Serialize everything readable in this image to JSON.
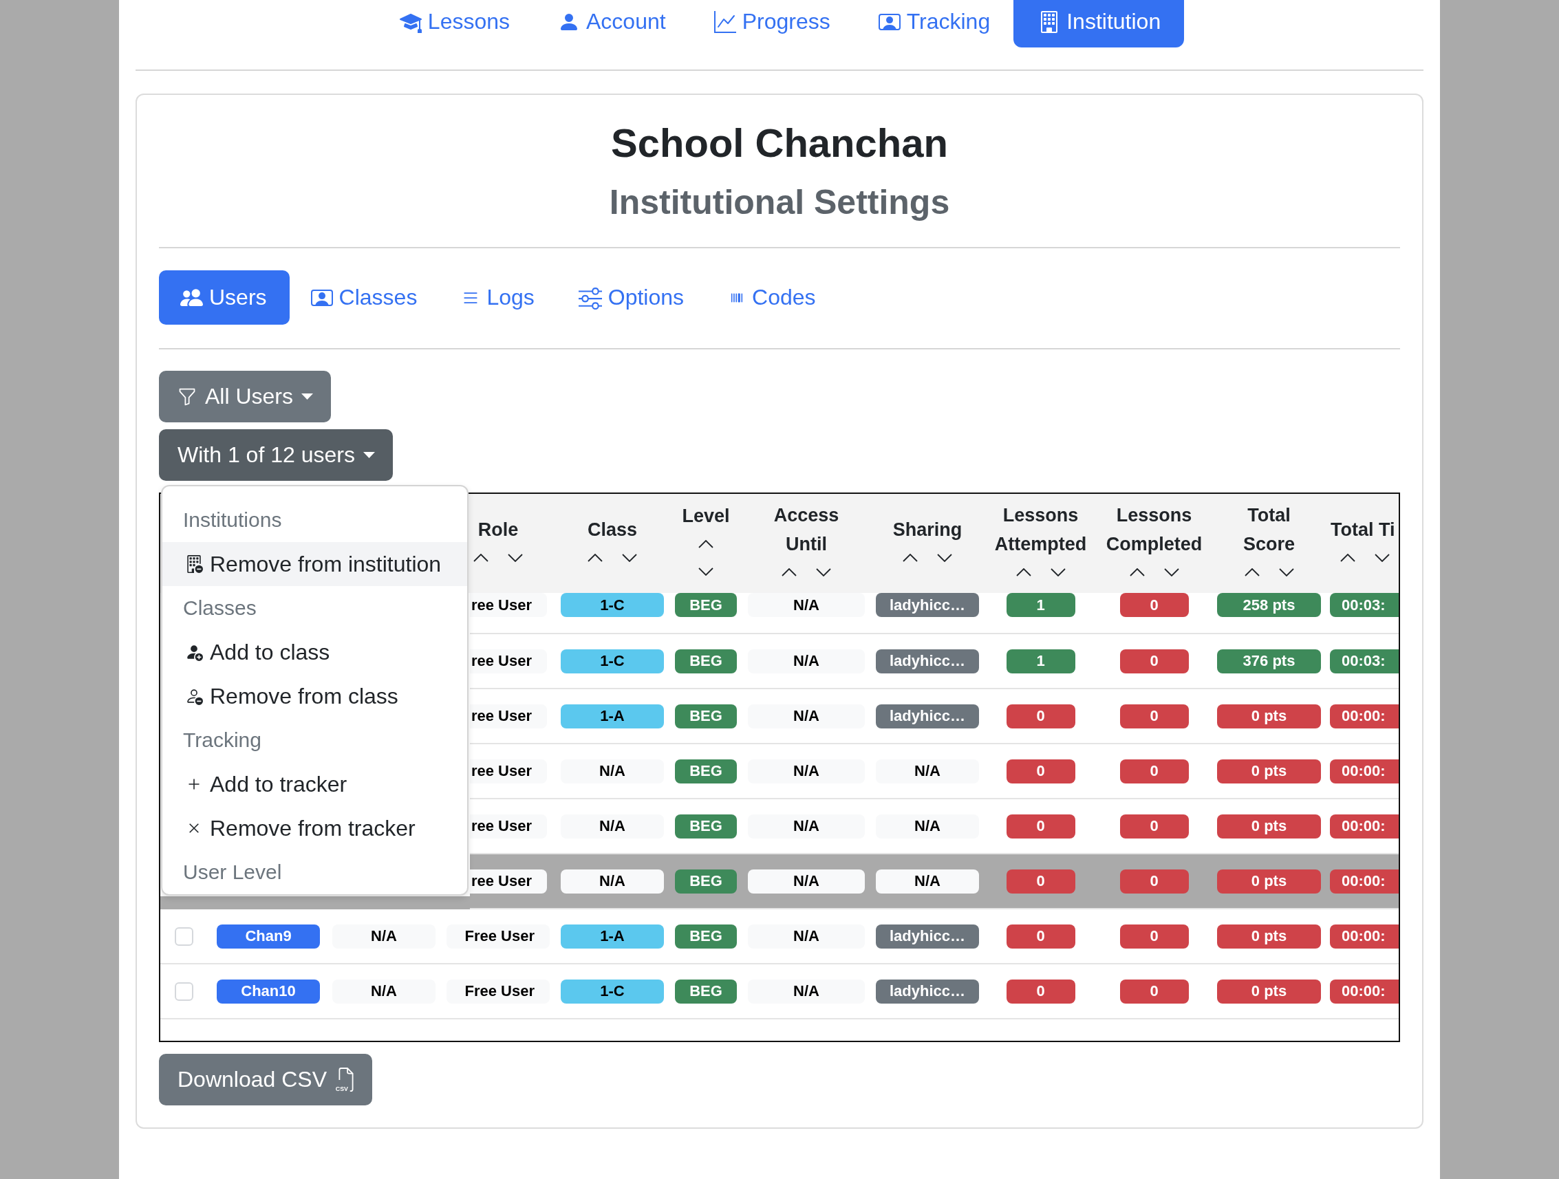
{
  "nav": {
    "items": [
      {
        "label": "Lessons",
        "selected": false
      },
      {
        "label": "Account",
        "selected": false
      },
      {
        "label": "Progress",
        "selected": false
      },
      {
        "label": "Tracking",
        "selected": false
      },
      {
        "label": "Institution",
        "selected": true
      }
    ]
  },
  "header": {
    "title": "School Chanchan",
    "subtitle": "Institutional Settings"
  },
  "tabs": [
    {
      "label": "Users",
      "selected": true
    },
    {
      "label": "Classes",
      "selected": false
    },
    {
      "label": "Logs",
      "selected": false
    },
    {
      "label": "Options",
      "selected": false
    },
    {
      "label": "Codes",
      "selected": false
    }
  ],
  "filter_button": {
    "label": "All Users"
  },
  "bulk_button": {
    "label": "With 1 of 12 users",
    "expanded": true
  },
  "bulk_menu": [
    {
      "kind": "header",
      "label": "Institutions"
    },
    {
      "kind": "item",
      "label": "Remove from institution",
      "highlighted": true
    },
    {
      "kind": "header",
      "label": "Classes"
    },
    {
      "kind": "item",
      "label": "Add to class",
      "highlighted": false
    },
    {
      "kind": "item",
      "label": "Remove from class",
      "highlighted": false
    },
    {
      "kind": "header",
      "label": "Tracking"
    },
    {
      "kind": "item",
      "label": "Add to tracker",
      "highlighted": false
    },
    {
      "kind": "item",
      "label": "Remove from tracker",
      "highlighted": false
    },
    {
      "kind": "header",
      "label": "User Level"
    }
  ],
  "table": {
    "columns": [
      {
        "label": "Role"
      },
      {
        "label": "Class"
      },
      {
        "label": "Level"
      },
      {
        "label": "Access Until"
      },
      {
        "label": "Sharing"
      },
      {
        "label": "Lessons Attempted"
      },
      {
        "label": "Lessons Completed"
      },
      {
        "label": "Total Score"
      },
      {
        "label": "Total Ti"
      }
    ],
    "rows": [
      {
        "selected": false,
        "role": {
          "text": "ree User",
          "color": "#f8f9fa"
        },
        "class": {
          "text": "1-C",
          "color": "#5bc8ee"
        },
        "level": {
          "text": "BEG",
          "color": "#3e8a5a"
        },
        "access_until": {
          "text": "N/A",
          "color": "#f8f9fa"
        },
        "sharing": {
          "text": "ladyhicc…",
          "color": "#6c757d"
        },
        "lessons_attempted": {
          "text": "1",
          "color": "#3e8a5a"
        },
        "lessons_completed": {
          "text": "0",
          "color": "#cf4349"
        },
        "total_score": {
          "text": "258 pts",
          "color": "#3e8a5a"
        },
        "column_12": {
          "text": "00:03:",
          "color": "#3e8a5a"
        }
      },
      {
        "selected": false,
        "role": {
          "text": "ree User",
          "color": "#f8f9fa"
        },
        "class": {
          "text": "1-C",
          "color": "#5bc8ee"
        },
        "level": {
          "text": "BEG",
          "color": "#3e8a5a"
        },
        "access_until": {
          "text": "N/A",
          "color": "#f8f9fa"
        },
        "sharing": {
          "text": "ladyhicc…",
          "color": "#6c757d"
        },
        "lessons_attempted": {
          "text": "1",
          "color": "#3e8a5a"
        },
        "lessons_completed": {
          "text": "0",
          "color": "#cf4349"
        },
        "total_score": {
          "text": "376 pts",
          "color": "#3e8a5a"
        },
        "column_12": {
          "text": "00:03:",
          "color": "#3e8a5a"
        }
      },
      {
        "selected": false,
        "role": {
          "text": "ree User",
          "color": "#f8f9fa"
        },
        "class": {
          "text": "1-A",
          "color": "#5bc8ee"
        },
        "level": {
          "text": "BEG",
          "color": "#3e8a5a"
        },
        "access_until": {
          "text": "N/A",
          "color": "#f8f9fa"
        },
        "sharing": {
          "text": "ladyhicc…",
          "color": "#6c757d"
        },
        "lessons_attempted": {
          "text": "0",
          "color": "#cf4349"
        },
        "lessons_completed": {
          "text": "0",
          "color": "#cf4349"
        },
        "total_score": {
          "text": "0 pts",
          "color": "#cf4349"
        },
        "column_12": {
          "text": "00:00:",
          "color": "#cf4349"
        }
      },
      {
        "selected": false,
        "role": {
          "text": "ree User",
          "color": "#f8f9fa"
        },
        "class": {
          "text": "N/A",
          "color": "#f8f9fa"
        },
        "level": {
          "text": "BEG",
          "color": "#3e8a5a"
        },
        "access_until": {
          "text": "N/A",
          "color": "#f8f9fa"
        },
        "sharing": {
          "text": "N/A",
          "color": "#f8f9fa"
        },
        "lessons_attempted": {
          "text": "0",
          "color": "#cf4349"
        },
        "lessons_completed": {
          "text": "0",
          "color": "#cf4349"
        },
        "total_score": {
          "text": "0 pts",
          "color": "#cf4349"
        },
        "column_12": {
          "text": "00:00:",
          "color": "#cf4349"
        }
      },
      {
        "selected": false,
        "role": {
          "text": "ree User",
          "color": "#f8f9fa"
        },
        "class": {
          "text": "N/A",
          "color": "#f8f9fa"
        },
        "level": {
          "text": "BEG",
          "color": "#3e8a5a"
        },
        "access_until": {
          "text": "N/A",
          "color": "#f8f9fa"
        },
        "sharing": {
          "text": "N/A",
          "color": "#f8f9fa"
        },
        "lessons_attempted": {
          "text": "0",
          "color": "#cf4349"
        },
        "lessons_completed": {
          "text": "0",
          "color": "#cf4349"
        },
        "total_score": {
          "text": "0 pts",
          "color": "#cf4349"
        },
        "column_12": {
          "text": "00:00:",
          "color": "#cf4349"
        }
      },
      {
        "selected": true,
        "role": {
          "text": "ree User",
          "color": "#f8f9fa"
        },
        "class": {
          "text": "N/A",
          "color": "#f8f9fa"
        },
        "level": {
          "text": "BEG",
          "color": "#3e8a5a"
        },
        "access_until": {
          "text": "N/A",
          "color": "#f8f9fa"
        },
        "sharing": {
          "text": "N/A",
          "color": "#f8f9fa"
        },
        "lessons_attempted": {
          "text": "0",
          "color": "#cf4349"
        },
        "lessons_completed": {
          "text": "0",
          "color": "#cf4349"
        },
        "total_score": {
          "text": "0 pts",
          "color": "#cf4349"
        },
        "column_12": {
          "text": "00:00:",
          "color": "#cf4349"
        }
      },
      {
        "selected": false,
        "checked": false,
        "column_2": {
          "text": "Chan9",
          "color": "#3471f2"
        },
        "column_3": {
          "text": "N/A",
          "color": "#f8f9fa"
        },
        "role": {
          "text": "Free User",
          "color": "#f8f9fa"
        },
        "class": {
          "text": "1-A",
          "color": "#5bc8ee"
        },
        "level": {
          "text": "BEG",
          "color": "#3e8a5a"
        },
        "access_until": {
          "text": "N/A",
          "color": "#f8f9fa"
        },
        "sharing": {
          "text": "ladyhicc…",
          "color": "#6c757d"
        },
        "lessons_attempted": {
          "text": "0",
          "color": "#cf4349"
        },
        "lessons_completed": {
          "text": "0",
          "color": "#cf4349"
        },
        "total_score": {
          "text": "0 pts",
          "color": "#cf4349"
        },
        "column_12": {
          "text": "00:00:",
          "color": "#cf4349"
        }
      },
      {
        "selected": false,
        "checked": false,
        "column_2": {
          "text": "Chan10",
          "color": "#3471f2"
        },
        "column_3": {
          "text": "N/A",
          "color": "#f8f9fa"
        },
        "role": {
          "text": "Free User",
          "color": "#f8f9fa"
        },
        "class": {
          "text": "1-C",
          "color": "#5bc8ee"
        },
        "level": {
          "text": "BEG",
          "color": "#3e8a5a"
        },
        "access_until": {
          "text": "N/A",
          "color": "#f8f9fa"
        },
        "sharing": {
          "text": "ladyhicc…",
          "color": "#6c757d"
        },
        "lessons_attempted": {
          "text": "0",
          "color": "#cf4349"
        },
        "lessons_completed": {
          "text": "0",
          "color": "#cf4349"
        },
        "total_score": {
          "text": "0 pts",
          "color": "#cf4349"
        },
        "column_12": {
          "text": "00:00:",
          "color": "#cf4349"
        }
      }
    ]
  },
  "download_button": {
    "label": "Download CSV",
    "icon_text": "CSV"
  }
}
